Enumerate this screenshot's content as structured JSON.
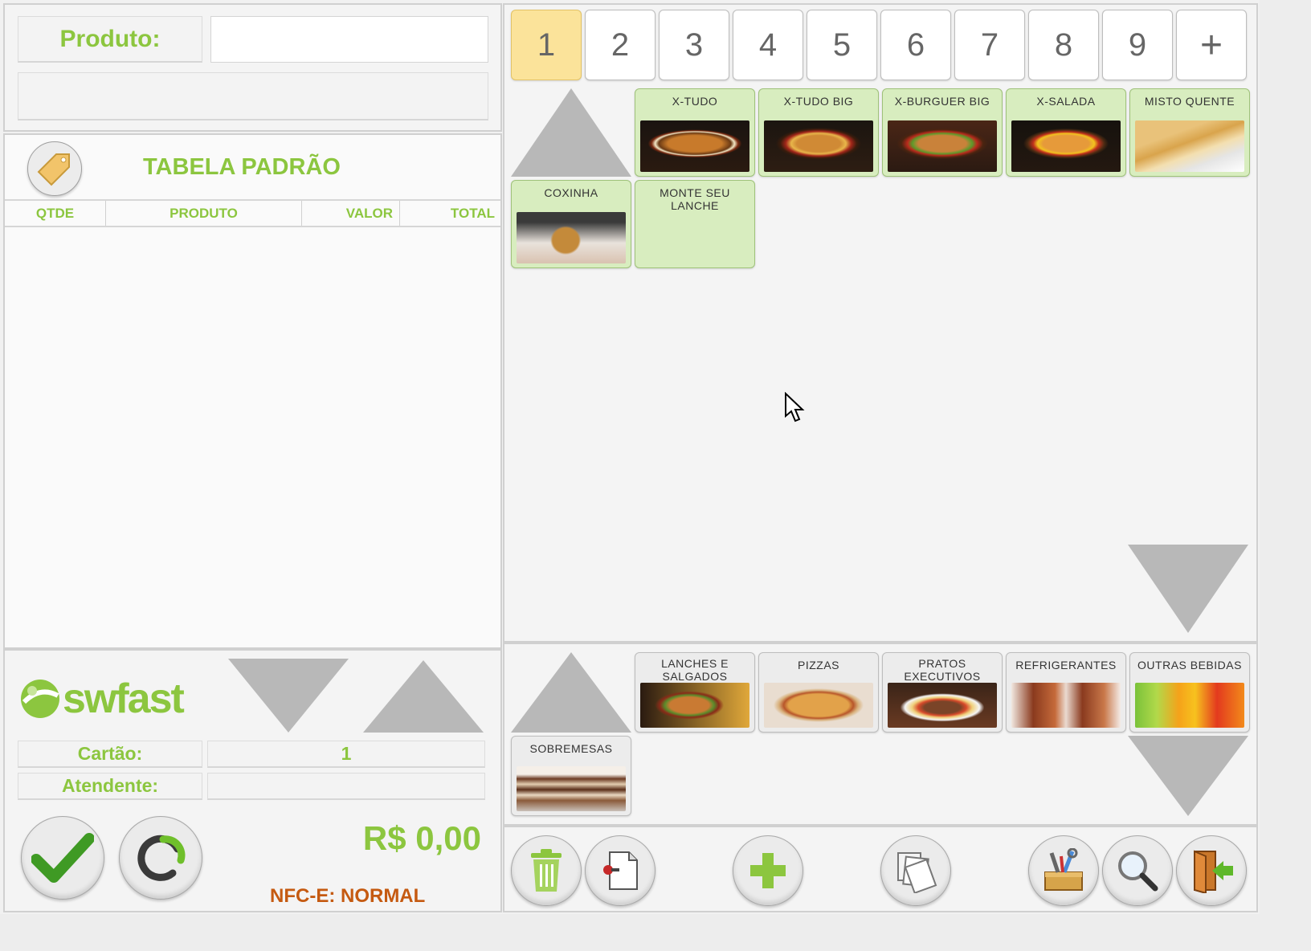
{
  "product_panel": {
    "label": "Produto:",
    "input_value": "",
    "description": ""
  },
  "price_table": {
    "title": "TABELA PADRÃO",
    "icon": "price-tag-icon"
  },
  "order_table": {
    "columns": [
      "QTDE",
      "PRODUTO",
      "VALOR",
      "TOTAL"
    ],
    "rows": []
  },
  "brand": {
    "name": "swfast"
  },
  "footer_info": {
    "card_label": "Cartão:",
    "card_value": "1",
    "attendant_label": "Atendente:",
    "attendant_value": ""
  },
  "total": {
    "amount": "R$ 0,00",
    "nfce_status": "NFC-E: NORMAL"
  },
  "page_tabs": [
    "1",
    "2",
    "3",
    "4",
    "5",
    "6",
    "7",
    "8",
    "9",
    "+"
  ],
  "products": [
    {
      "name": "X-TUDO",
      "image": "burger"
    },
    {
      "name": "X-TUDO BIG",
      "image": "burger"
    },
    {
      "name": "X-BURGUER BIG",
      "image": "burger"
    },
    {
      "name": "X-SALADA",
      "image": "burger"
    },
    {
      "name": "MISTO QUENTE",
      "image": "toast"
    },
    {
      "name": "COXINHA",
      "image": "coxinha"
    },
    {
      "name": "MONTE SEU LANCHE",
      "image": ""
    }
  ],
  "categories": [
    {
      "name": "LANCHES E SALGADOS",
      "image": "burger-fries"
    },
    {
      "name": "PIZZAS",
      "image": "pizza"
    },
    {
      "name": "PRATOS EXECUTIVOS",
      "image": "plate"
    },
    {
      "name": "REFRIGERANTES",
      "image": "soda"
    },
    {
      "name": "OUTRAS BEBIDAS",
      "image": "juice"
    },
    {
      "name": "SOBREMESAS",
      "image": "cake"
    }
  ],
  "toolbar": [
    "trash-icon",
    "document-icon",
    "plus-icon",
    "copy-icon",
    "toolbox-icon",
    "search-icon",
    "exit-door-icon"
  ],
  "colors": {
    "accent": "#8cc63f",
    "active_tab": "#fbe39a",
    "product_tile": "#d8edbf",
    "nfce": "#c55a11"
  }
}
